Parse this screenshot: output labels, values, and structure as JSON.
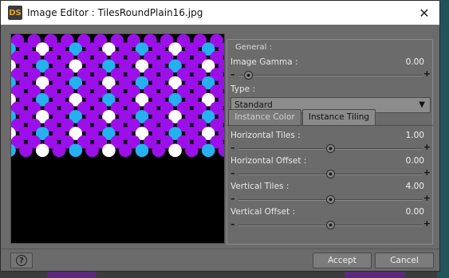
{
  "window": {
    "title": "Image Editor : TilesRoundPlain16.jpg",
    "logo_text": "DS",
    "close_glyph": "✕"
  },
  "preview": {
    "icon": "tile-preview-image",
    "colors": {
      "background": "#000000",
      "purple": "#9b10e8",
      "blue": "#25b0f0",
      "white": "#ffffff"
    }
  },
  "general": {
    "legend": "General :",
    "image_gamma": {
      "label": "Image Gamma :",
      "value": "0.00",
      "fraction": 0.03
    },
    "type": {
      "label": "Type :",
      "selected": "Standard"
    }
  },
  "tabs": {
    "instance_color": "Instance Color",
    "instance_tiling": "Instance Tiling"
  },
  "tiling": {
    "horizontal_tiles": {
      "label": "Horizontal Tiles :",
      "value": "1.00",
      "fraction": 0.5
    },
    "horizontal_offset": {
      "label": "Horizontal Offset :",
      "value": "0.00",
      "fraction": 0.5
    },
    "vertical_tiles": {
      "label": "Vertical Tiles :",
      "value": "4.00",
      "fraction": 0.5
    },
    "vertical_offset": {
      "label": "Vertical Offset :",
      "value": "0.00",
      "fraction": 0.5
    }
  },
  "slider_glyphs": {
    "minus": "–",
    "plus": "+"
  },
  "footer": {
    "help_glyph": "?",
    "accept": "Accept",
    "cancel": "Cancel"
  }
}
